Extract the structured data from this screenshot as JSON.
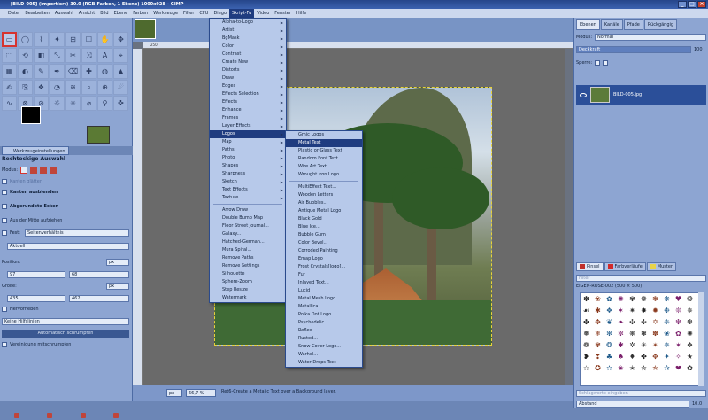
{
  "window": {
    "title": "[BILD-005] (importiert)-30.0 (RGB-Farben, 1 Ebene) 1000x928 – GIMP"
  },
  "menubar": [
    "Datei",
    "Bearbeiten",
    "Auswahl",
    "Ansicht",
    "Bild",
    "Ebene",
    "Farben",
    "Werkzeuge",
    "Filter",
    "CFU",
    "Diego",
    "Skript-Fu",
    "Video",
    "Fenster",
    "Hilfe"
  ],
  "menubar_active": "Skript-Fu",
  "toolbox": {
    "tools": [
      "▭",
      "◯",
      "⌇",
      "✦",
      "⊞",
      "☐",
      "✋",
      "✥",
      "⬚",
      "⟲",
      "◧",
      "⤡",
      "✂",
      "⤨",
      "A",
      "⌖",
      "▦",
      "◐",
      "✎",
      "✒",
      "⌫",
      "✚",
      "◍",
      "▲",
      "✍",
      "⎘",
      "❖",
      "◔",
      "≋",
      "⌕",
      "⊕",
      "☄",
      "∿",
      "⊗",
      "⊘",
      "☼",
      "✳",
      "⌀",
      "⚲",
      "✜"
    ],
    "options_tab": "Werkzeugeinstellungen",
    "options_title": "Rechteckige Auswahl",
    "mode_label": "Modus:",
    "antialias": "Kanten glätten",
    "feather": "Kanten ausblenden",
    "rounded": "Abgerundete Ecken",
    "expand_center": "Aus der Mitte aufziehen",
    "fixed_label": "Fest:",
    "fixed_value": "Seitenverhältnis",
    "aspect_value": "Aktuell",
    "position_label": "Position:",
    "position_unit": "px",
    "pos_x": "97",
    "pos_y": "68",
    "size_label": "Größe:",
    "size_unit": "px",
    "size_w": "435",
    "size_h": "462",
    "highlight": "Hervorheben",
    "guides_value": "Keine Hilfslinien",
    "autoshrink": "Automatisch schrumpfen",
    "shrink_merged": "Vereinigung mitschrumpfen"
  },
  "imagewin": {
    "ruler_mark": "250",
    "unit": "px",
    "zoom": "66,7 %",
    "status_msg": "Ret6-Create a Metalic Text over a Background layer."
  },
  "scriptfu_menu": [
    "Alpha-to-Logo",
    "Artist",
    "BgMask",
    "Color",
    "Contrast",
    "Create New",
    "Distorts",
    "Draw",
    "Edges",
    "Effects Selection",
    "Effects",
    "Enhance",
    "Frames",
    "Layer Effects",
    "Logos",
    "Map",
    "Paths",
    "Photo",
    "Shapes",
    "Sharpness",
    "Sketch",
    "Text Effects",
    "Texture",
    "Arrow Draw",
    "Double Bump Map",
    "Floor Street Journal...",
    "Galaxy...",
    "Hatched-German...",
    "Mura Spiral...",
    "Remove Paths",
    "Remove Settings",
    "Silhouette",
    "Sphere-Zoom",
    "Step Resize",
    "Watermark"
  ],
  "logos_menu": [
    "Gmic Logos",
    "Metal Text",
    "Plastic or Glass Text",
    "Random Font Text...",
    "Wire Art Text",
    "Wrought Iron Logo",
    "MultiEffect Text...",
    "Wooden Letters",
    "Air Bubbles...",
    "Antique Metal Logo",
    "Black Gold",
    "Blue Ice...",
    "Bubble Gum",
    "Color Bevel...",
    "Corroded Painting",
    "Emap Logo",
    "Frost Crystals[logo]...",
    "Fur",
    "Inlayed Text...",
    "Lucid",
    "Metal Mesh Logo",
    "Metallica",
    "Polka Dot Logo",
    "Psychedelic",
    "Reflex...",
    "Rusted...",
    "Snow Cover Logo...",
    "Warhol...",
    "Water Drops Text"
  ],
  "dock": {
    "tabs": [
      "Ebenen",
      "Kanäle",
      "Pfade",
      "Rückgängig"
    ],
    "mode_label": "Modus:",
    "mode_value": "Normal",
    "opacity_label": "Deckkraft",
    "opacity_value": "100",
    "lock_label": "Sperre:",
    "layer_name": "BILD-005.jpg",
    "brush_tabs": [
      "Pinsel",
      "Farbverläufe",
      "Muster"
    ],
    "filter_placeholder": "Filter",
    "brush_name": "EIGEN-ROSE-002 (500 × 500)",
    "tag_placeholder": "Schlagworte eingeben",
    "spacing_label": "Abstand",
    "spacing_value": "10.0"
  },
  "brush_glyphs": [
    "✽",
    "❀",
    "✿",
    "✺",
    "✾",
    "❁",
    "❃",
    "❋",
    "♥",
    "❂",
    "☙",
    "✱",
    "❖",
    "✶",
    "✷",
    "✸",
    "✹",
    "❉",
    "❊",
    "✵",
    "✤",
    "✥",
    "❦",
    "❧",
    "✣",
    "✢",
    "✡",
    "❈",
    "❇",
    "❆",
    "❅",
    "❄",
    "✻",
    "✼",
    "❋",
    "❃",
    "✽",
    "❀",
    "✿",
    "✺",
    "❁",
    "✾",
    "❂",
    "✱",
    "✲",
    "✳",
    "✴",
    "✵",
    "✶",
    "❖",
    "❥",
    "❣",
    "♣",
    "♠",
    "♦",
    "✤",
    "✥",
    "✦",
    "✧",
    "★",
    "☆",
    "✪",
    "✫",
    "✬",
    "✭",
    "✮",
    "✯",
    "✰",
    "❤",
    "✿"
  ],
  "colors": {
    "accent": "#1f3c80",
    "highlight": "#1f3c80",
    "selected_border": "#d6332f"
  }
}
